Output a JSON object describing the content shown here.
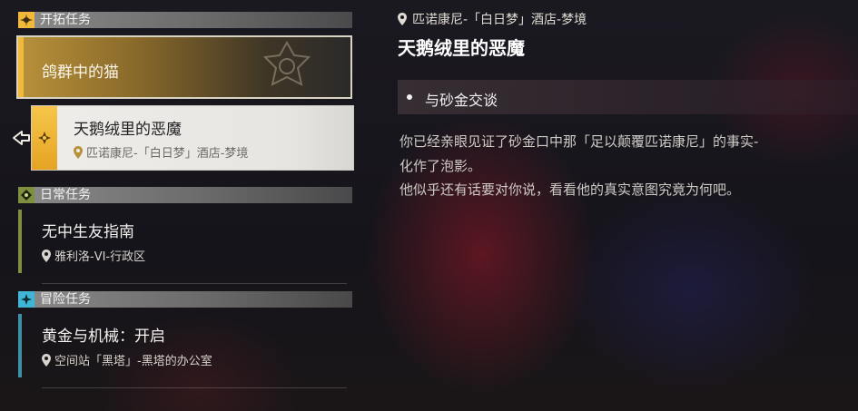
{
  "quest_list": {
    "trailblaze": {
      "header": "开拓任务",
      "items": [
        {
          "title": "鸽群中的猫"
        },
        {
          "title": "天鹅绒里的恶魔",
          "location": "匹诺康尼-「白日梦」酒店-梦境"
        }
      ]
    },
    "daily": {
      "header": "日常任务",
      "items": [
        {
          "title": "无中生友指南",
          "location": "雅利洛-VI-行政区"
        }
      ]
    },
    "adventure": {
      "header": "冒险任务",
      "items": [
        {
          "title": "黄金与机械：开启",
          "location": "空间站「黑塔」-黑塔的办公室"
        }
      ]
    }
  },
  "detail": {
    "location": "匹诺康尼-「白日梦」酒店-梦境",
    "title": "天鹅绒里的恶魔",
    "objective": "与砂金交谈",
    "description": [
      "你已经亲眼见证了砂金口中那「足以颠覆匹诺康尼」的事实-",
      "化作了泡影。",
      "他似乎还有话要对你说，看看他的真实意图究竟为何吧。"
    ]
  },
  "colors": {
    "trailblaze_accent": "#f0b93a",
    "daily_accent": "#7e8f3f",
    "adventure_accent": "#3f8fa6"
  }
}
